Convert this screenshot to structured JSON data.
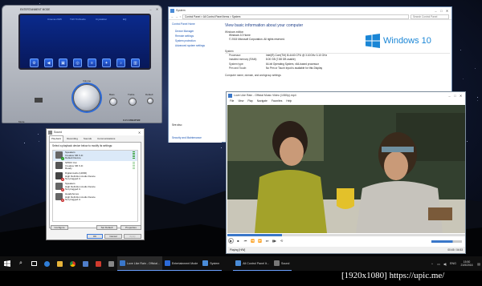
{
  "creative": {
    "title": "ENTERTAINMENT MODE",
    "tabs": [
      "Cinema 2015",
      "THX TruStudio",
      "Crystalizer",
      "EQ"
    ],
    "volume_label": "Volume",
    "bass_label": "Bass",
    "treble_label": "Treble",
    "default_label": "Default",
    "mode_label": "Mode",
    "brand": "X-Fi CREATIVE"
  },
  "sound": {
    "title": "Sound",
    "tabs": [
      "Playback",
      "Recording",
      "Sounds",
      "Communications"
    ],
    "instruction": "Select a playback device below to modify its settings:",
    "devices": [
      {
        "name": "Speakers",
        "sub1": "Creative SB X-Fi",
        "sub2": "Default Device",
        "status": "ok"
      },
      {
        "name": "SPDIF Out",
        "sub1": "Creative SB X-Fi",
        "sub2": "Ready",
        "status": ""
      },
      {
        "name": "Digital Audio (HDMI)",
        "sub1": "High Definition Audio Device",
        "sub2": "Not plugged in",
        "status": "x"
      },
      {
        "name": "Speakers",
        "sub1": "High Definition Audio Device",
        "sub2": "Not plugged in",
        "status": "x"
      },
      {
        "name": "Headphones",
        "sub1": "High Definition Audio Device",
        "sub2": "Not plugged in",
        "status": "x"
      }
    ],
    "configure_label": "Configure",
    "set_default_label": "Set Default",
    "properties_label": "Properties",
    "ok_label": "OK",
    "cancel_label": "Cancel",
    "apply_label": "Apply"
  },
  "system": {
    "title": "System",
    "breadcrumb": "Control Panel  >  All Control Panel Items  >  System",
    "search_placeholder": "Search Control Panel",
    "sidebar": [
      "Control Panel Home",
      "Device Manager",
      "Remote settings",
      "System protection",
      "Advanced system settings"
    ],
    "see_also": "See also",
    "security": "Security and Maintenance",
    "heading": "View basic information about your computer",
    "edition_section": "Windows edition",
    "edition": "Windows 10 Home",
    "copyright": "© 2015 Microsoft Corporation. All rights reserved.",
    "windows_logo": "Windows 10",
    "system_section": "System",
    "rows": [
      {
        "k": "Processor:",
        "v": "Intel(R) Core(TM) i5-4440 CPU @ 3.10GHz   3.10 GHz"
      },
      {
        "k": "Installed memory (RAM):",
        "v": "8.00 GB (7.88 GB usable)"
      },
      {
        "k": "System type:",
        "v": "64-bit Operating System, x64-based processor"
      },
      {
        "k": "Pen and Touch:",
        "v": "No Pen or Touch Input is available for this Display"
      }
    ],
    "computer_section": "Computer name, domain, and workgroup settings"
  },
  "media": {
    "title": "Love Like Rain - Official Music Video (1080p).mp4",
    "menu": [
      "File",
      "View",
      "Play",
      "Navigate",
      "Favorites",
      "Help"
    ],
    "status": "Playing [H/W]",
    "time": "00:45 / 04:53"
  },
  "taskbar": {
    "apps": [
      {
        "label": "Love Like Rain - Official...",
        "color": "#3a77c9"
      },
      {
        "label": "Entertainment Mode",
        "color": "#2c6ad8"
      },
      {
        "label": "System",
        "color": "#4a8cd8"
      },
      {
        "label": "All Control Panel It...",
        "color": "#4a8cd8"
      },
      {
        "label": "Sound",
        "color": "#777777"
      }
    ],
    "lang": "ENG",
    "time": "15:50",
    "date": "21/5/2016"
  },
  "watermark": "[1920x1080] https://upic.me/"
}
